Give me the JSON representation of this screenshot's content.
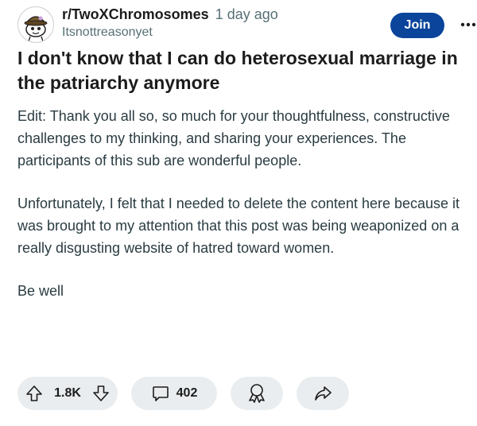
{
  "post": {
    "subreddit": "r/TwoXChromosomes",
    "time_ago": "1 day ago",
    "author": "Itsnottreasonyet",
    "join_label": "Join",
    "title": "I don't know that I can do heterosexual marriage in the patriarchy anymore",
    "paragraphs": [
      "Edit: Thank you all so, so much for your thoughtfulness, constructive challenges to my thinking, and sharing your experiences. The participants of this sub are wonderful people.",
      "Unfortunately, I felt that I needed to delete the content here because it was brought to my attention that this post was being weaponized on a really disgusting website of hatred toward women.",
      "Be well"
    ]
  },
  "actions": {
    "upvotes": "1.8K",
    "comments": "402"
  },
  "icons": {
    "avatar": "snoo-avatar-icon",
    "more": "more-options-icon",
    "upvote": "upvote-arrow-icon",
    "downvote": "downvote-arrow-icon",
    "comment": "comment-bubble-icon",
    "award": "award-icon",
    "share": "share-arrow-icon"
  },
  "colors": {
    "join_button": "#0a449b",
    "pill_background": "#eaedef",
    "body_text": "#2a3c42",
    "meta_text": "#576f76"
  }
}
